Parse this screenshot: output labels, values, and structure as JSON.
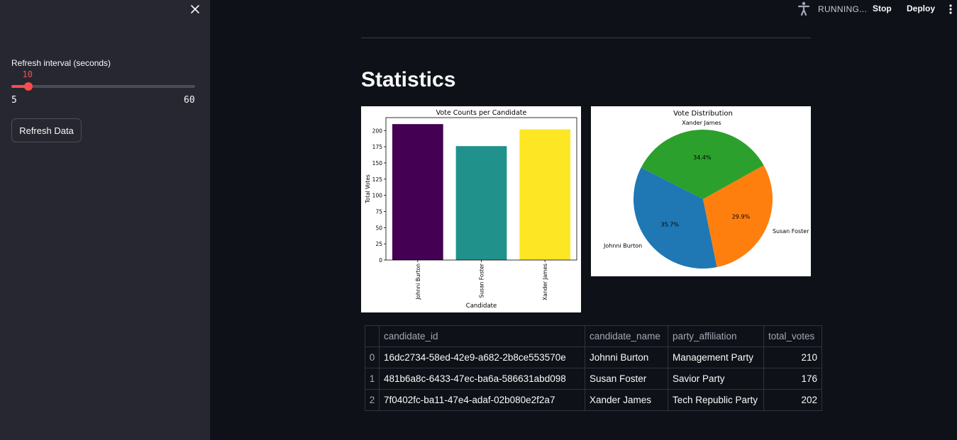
{
  "sidebar": {
    "slider": {
      "label": "Refresh interval (seconds)",
      "value": 10,
      "value_text": "10",
      "min": 5,
      "max": 60,
      "min_text": "5",
      "max_text": "60"
    },
    "refresh_button": "Refresh Data"
  },
  "header": {
    "status": "RUNNING...",
    "stop_label": "Stop",
    "deploy_label": "Deploy"
  },
  "main": {
    "title": "Statistics"
  },
  "chart_data": [
    {
      "type": "bar",
      "title": "Vote Counts per Candidate",
      "xlabel": "Candidate",
      "ylabel": "Total Votes",
      "categories": [
        "Johnni Burton",
        "Susan Foster",
        "Xander James"
      ],
      "values": [
        210,
        176,
        202
      ],
      "colors": [
        "#440154",
        "#21918c",
        "#fde725"
      ],
      "yticks": [
        0,
        25,
        50,
        75,
        100,
        125,
        150,
        175,
        200
      ],
      "ylim": [
        0,
        220
      ]
    },
    {
      "type": "pie",
      "title": "Vote Distribution",
      "labels": [
        "Johnni Burton",
        "Susan Foster",
        "Xander James"
      ],
      "values": [
        35.7,
        29.9,
        34.4
      ],
      "value_labels": [
        "35.7%",
        "29.9%",
        "34.4%"
      ],
      "colors": [
        "#1f77b4",
        "#ff7f0e",
        "#2ca02c"
      ]
    }
  ],
  "table": {
    "columns": [
      "",
      "candidate_id",
      "candidate_name",
      "party_affiliation",
      "total_votes"
    ],
    "rows": [
      [
        "0",
        "16dc2734-58ed-42e9-a682-2b8ce553570e",
        "Johnni Burton",
        "Management Party",
        "210"
      ],
      [
        "1",
        "481b6a8c-6433-47ec-ba6a-586631abd098",
        "Susan Foster",
        "Savior Party",
        "176"
      ],
      [
        "2",
        "7f0402fc-ba11-47e4-adaf-02b080e2f2a7",
        "Xander James",
        "Tech Republic Party",
        "202"
      ]
    ]
  }
}
